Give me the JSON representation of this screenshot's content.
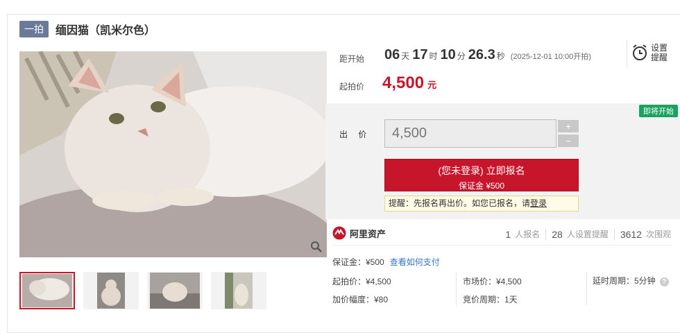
{
  "title": {
    "badge": "一拍",
    "text": "缅因猫（凯米尔色）"
  },
  "countdown": {
    "label": "距开始",
    "days": "06",
    "days_unit": "天",
    "hours": "17",
    "hours_unit": "时",
    "minutes": "10",
    "minutes_unit": "分",
    "seconds": "26.3",
    "seconds_unit": "秒",
    "note": "(2025-12-01 10:00开拍)"
  },
  "reminder": {
    "line1": "设置",
    "line2": "提醒"
  },
  "start_price": {
    "label": "起拍价",
    "value": "4,500",
    "unit": "元"
  },
  "bid": {
    "status_badge": "即将开始",
    "label": "出 价",
    "input_value": "4,500",
    "plus": "+",
    "minus": "−",
    "signup_main": "(您未登录) 立即报名",
    "signup_sub": "保证金 ¥500",
    "tip_prefix": "提醒：先报名再出价。如您已报名，请",
    "tip_link": "登录"
  },
  "stats": {
    "brand": "阿里资产",
    "signups": "1",
    "signups_label": "人报名",
    "reminders": "28",
    "reminders_label": "人设置提醒",
    "views": "3612",
    "views_label": "次围观"
  },
  "info": {
    "deposit": "保证金：¥500",
    "deposit_link": "查看如何支付",
    "start_price": "起拍价：¥4,500",
    "market_price": "市场价：¥4,500",
    "delay": "延时周期：5分钟",
    "increment": "加价幅度：¥80",
    "cycle": "竞价周期：1天"
  },
  "colors": {
    "accent_red": "#c7162b",
    "badge_green": "#1aa260",
    "link_blue": "#3377c9",
    "title_badge": "#6b7a99"
  }
}
